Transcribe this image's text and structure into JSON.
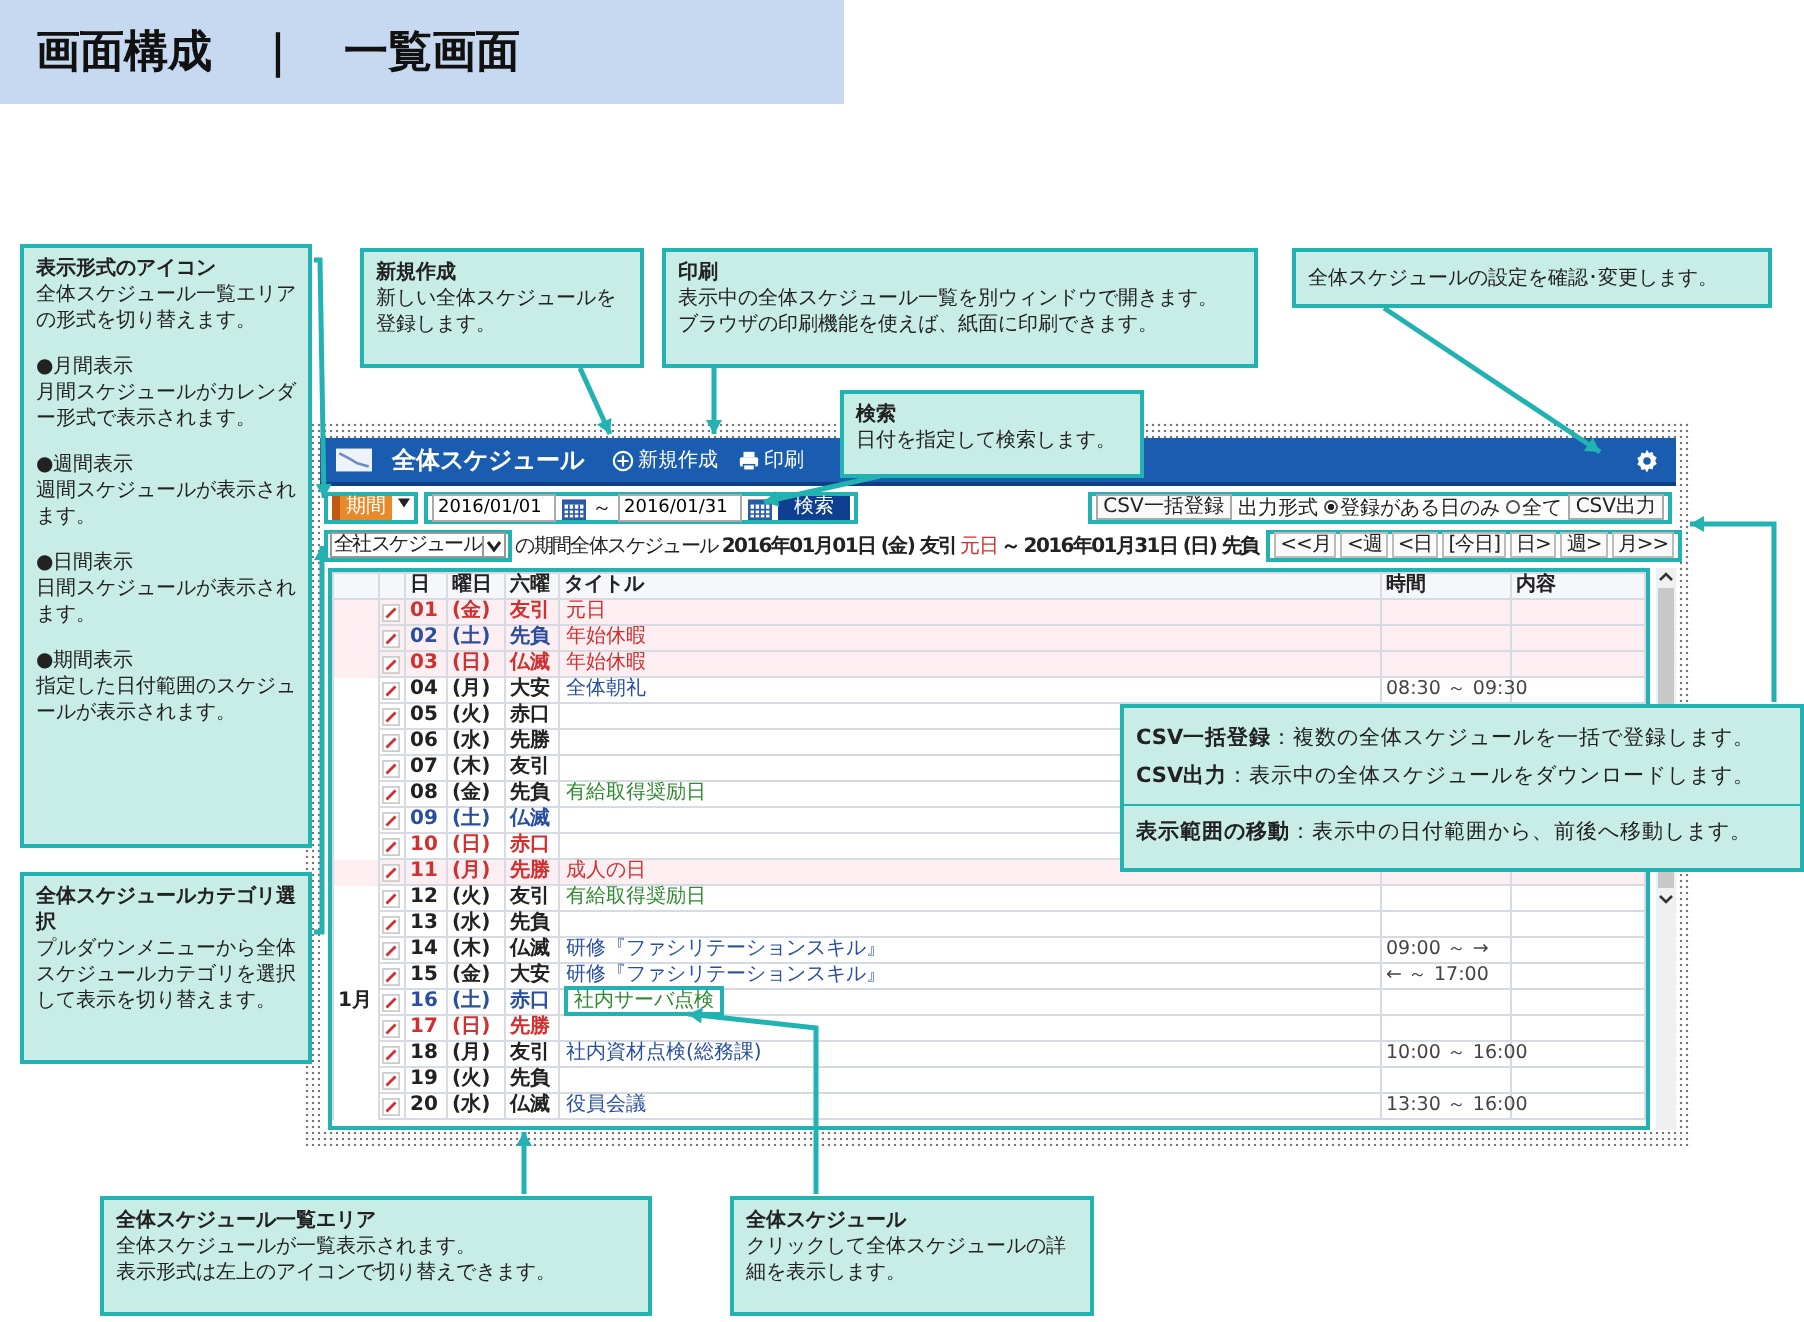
{
  "page_title": "画面構成　｜　一覧画面",
  "app": {
    "title": "全体スケジュール",
    "new_button": "新規作成",
    "print_button": "印刷",
    "view_mode": "期間",
    "date_from": "2016/01/01",
    "range_sep": "～",
    "date_to": "2016/01/31",
    "search_button": "検索",
    "csv_import_button": "CSV一括登録",
    "output_label": "出力形式",
    "output_options": [
      {
        "label": "登録がある日のみ",
        "selected": true
      },
      {
        "label": "全て",
        "selected": false
      }
    ],
    "csv_export_button": "CSV出力",
    "nav_buttons": [
      "<<月",
      "<週",
      "<日",
      "[今日]",
      "日>",
      "週>",
      "月>>"
    ],
    "category": "全社スケジュール",
    "summary": {
      "prefix": "の期間全体スケジュール",
      "start": "2016年01月01日 (金) 友引",
      "start_holiday": "元日",
      "sep": "～",
      "end": "2016年01月31日 (日) 先負"
    },
    "columns": [
      "日",
      "曜日",
      "六曜",
      "タイトル",
      "時間",
      "内容"
    ],
    "rows": [
      {
        "day": "01",
        "weekday": "(金)",
        "rokuyo": "友引",
        "kind": "holiday",
        "highlighted": true,
        "title": "元日",
        "color": "#d03030"
      },
      {
        "day": "02",
        "weekday": "(土)",
        "rokuyo": "先負",
        "kind": "saturday",
        "highlighted": true,
        "title": "年始休暇",
        "color": "#d03030"
      },
      {
        "day": "03",
        "weekday": "(日)",
        "rokuyo": "仏滅",
        "kind": "sunday",
        "highlighted": true,
        "title": "年始休暇",
        "color": "#d03030"
      },
      {
        "day": "04",
        "weekday": "(月)",
        "rokuyo": "大安",
        "kind": "weekday",
        "highlighted": false,
        "title": "全体朝礼",
        "color": "#2a4fa0",
        "time": "08:30 ～ 09:30"
      },
      {
        "day": "05",
        "weekday": "(火)",
        "rokuyo": "赤口",
        "kind": "weekday",
        "highlighted": false
      },
      {
        "day": "06",
        "weekday": "(水)",
        "rokuyo": "先勝",
        "kind": "weekday",
        "highlighted": false
      },
      {
        "day": "07",
        "weekday": "(木)",
        "rokuyo": "友引",
        "kind": "weekday",
        "highlighted": false
      },
      {
        "day": "08",
        "weekday": "(金)",
        "rokuyo": "先負",
        "kind": "weekday",
        "highlighted": false,
        "title": "有給取得奨励日",
        "color": "#2e8a2e"
      },
      {
        "day": "09",
        "weekday": "(土)",
        "rokuyo": "仏滅",
        "kind": "saturday",
        "highlighted": false
      },
      {
        "day": "10",
        "weekday": "(日)",
        "rokuyo": "赤口",
        "kind": "sunday",
        "highlighted": false
      },
      {
        "day": "11",
        "weekday": "(月)",
        "rokuyo": "先勝",
        "kind": "holiday",
        "highlighted": true,
        "title": "成人の日",
        "color": "#d03030"
      },
      {
        "day": "12",
        "weekday": "(火)",
        "rokuyo": "友引",
        "kind": "weekday",
        "highlighted": false,
        "title": "有給取得奨励日",
        "color": "#2e8a2e"
      },
      {
        "day": "13",
        "weekday": "(水)",
        "rokuyo": "先負",
        "kind": "weekday",
        "highlighted": false
      },
      {
        "day": "14",
        "weekday": "(木)",
        "rokuyo": "仏滅",
        "kind": "weekday",
        "highlighted": false,
        "title": "研修『ファシリテーションスキル』",
        "color": "#2a4fa0",
        "time": "09:00 ～ →"
      },
      {
        "day": "15",
        "weekday": "(金)",
        "rokuyo": "大安",
        "kind": "weekday",
        "highlighted": false,
        "title": "研修『ファシリテーションスキル』",
        "color": "#2a4fa0",
        "time": "← ～ 17:00"
      },
      {
        "month": "1月",
        "day": "16",
        "weekday": "(土)",
        "rokuyo": "赤口",
        "kind": "saturday",
        "highlighted": false,
        "title": "社内サーバ点検",
        "color": "#2e8a2e"
      },
      {
        "day": "17",
        "weekday": "(日)",
        "rokuyo": "先勝",
        "kind": "sunday",
        "highlighted": false
      },
      {
        "day": "18",
        "weekday": "(月)",
        "rokuyo": "友引",
        "kind": "weekday",
        "highlighted": false,
        "title": "社内資材点検(総務課)",
        "color": "#2a4fa0",
        "time": "10:00 ～ 16:00"
      },
      {
        "day": "19",
        "weekday": "(火)",
        "rokuyo": "先負",
        "kind": "weekday",
        "highlighted": false
      },
      {
        "day": "20",
        "weekday": "(水)",
        "rokuyo": "仏滅",
        "kind": "weekday",
        "highlighted": false,
        "title": "役員会議",
        "color": "#2a4fa0",
        "time": "13:30 ～ 16:00"
      }
    ]
  },
  "callouts": [
    {
      "title": "表示形式のアイコン",
      "blocks": [
        {
          "kind": "text",
          "text": "全体スケジュール一覧エリアの形式を切り替えます。"
        },
        {
          "kind": "heading",
          "text": "●月間表示"
        },
        {
          "kind": "text",
          "text": "月間スケジュールがカレンダー形式で表示されます。"
        },
        {
          "kind": "heading",
          "text": "●週間表示"
        },
        {
          "kind": "text",
          "text": "週間スケジュールが表示されます。"
        },
        {
          "kind": "heading",
          "text": "●日間表示"
        },
        {
          "kind": "text",
          "text": "日間スケジュールが表示されます。"
        },
        {
          "kind": "heading",
          "text": "●期間表示"
        },
        {
          "kind": "text",
          "text": "指定した日付範囲のスケジュールが表示されます。"
        }
      ]
    },
    {
      "title": "全体スケジュールカテゴリ選択",
      "blocks": [
        {
          "kind": "text",
          "text": "プルダウンメニューから全体スケジュールカテゴリを選択して表示を切り替えます。"
        }
      ]
    },
    {
      "title": "新規作成",
      "blocks": [
        {
          "kind": "text",
          "text": "新しい全体スケジュールを登録します。"
        }
      ]
    },
    {
      "title": "印刷",
      "blocks": [
        {
          "kind": "text",
          "text": "表示中の全体スケジュール一覧を別ウィンドウで開きます。"
        },
        {
          "kind": "text",
          "text": "ブラウザの印刷機能を使えば、紙面に印刷できます。"
        }
      ]
    },
    {
      "title": "検索",
      "blocks": [
        {
          "kind": "text",
          "text": "日付を指定して検索します。"
        }
      ]
    },
    {
      "blocks": [
        {
          "kind": "text",
          "text": "全体スケジュールの設定を確認･変更します。"
        }
      ]
    },
    {
      "blocks": [
        {
          "kind": "text",
          "text": "**CSV一括登録**：複数の全体スケジュールを一括で登録します。"
        },
        {
          "kind": "text",
          "text": "**CSV出力**：表示中の全体スケジュールをダウンロードします。"
        },
        {
          "kind": "separated",
          "text": "**表示範囲の移動**：表示中の日付範囲から、前後へ移動します。"
        }
      ]
    },
    {
      "title": "全体スケジュール一覧エリア",
      "blocks": [
        {
          "kind": "text",
          "text": "全体スケジュールが一覧表示されます。"
        },
        {
          "kind": "text",
          "text": "表示形式は左上のアイコンで切り替えできます。"
        }
      ]
    },
    {
      "title": "全体スケジュール",
      "blocks": [
        {
          "kind": "text",
          "text": "クリックして全体スケジュールの詳細を表示します。"
        }
      ]
    }
  ]
}
